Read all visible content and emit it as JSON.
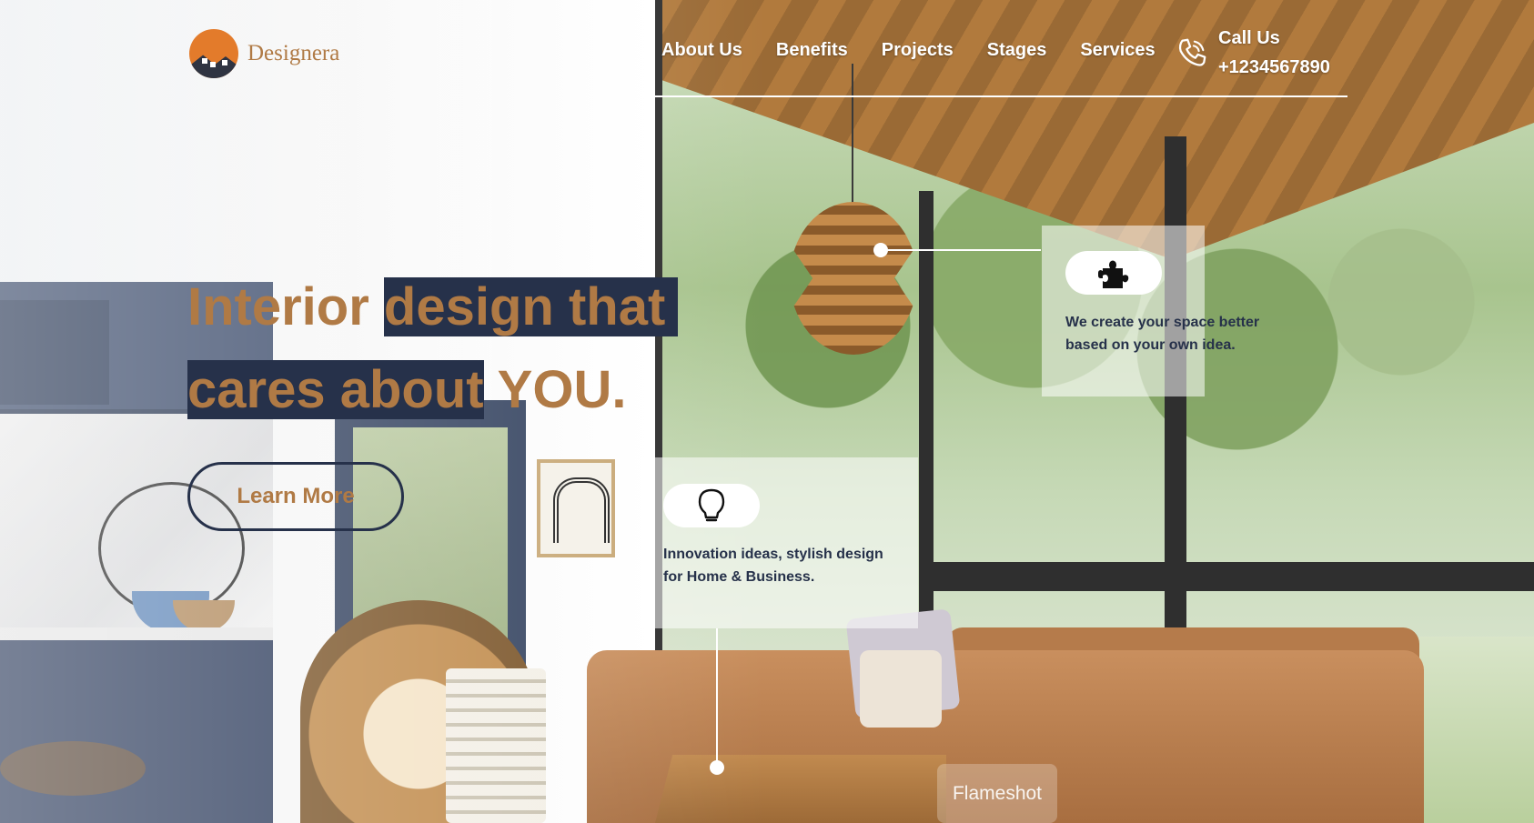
{
  "logo": {
    "name": "Designera",
    "color": "#b07a45",
    "mark_color": "#e37b2b"
  },
  "nav": {
    "items": [
      {
        "label": "About Us"
      },
      {
        "label": "Benefits"
      },
      {
        "label": "Projects"
      },
      {
        "label": "Stages"
      },
      {
        "label": "Services"
      }
    ]
  },
  "call": {
    "label": "Call Us",
    "phone": "+1234567890",
    "icon": "phone-icon"
  },
  "hero": {
    "line1_plain": "Interior ",
    "line1_highlight": "design that",
    "line2_highlight": "cares about",
    "line2_plain": " YOU.",
    "accent_color": "#b07a45",
    "highlight_color": "#26314a",
    "cta_label": "Learn More"
  },
  "features": [
    {
      "icon": "puzzle-icon",
      "text_line1": "We create your space better",
      "text_line2": "based on your own idea."
    },
    {
      "icon": "lightbulb-icon",
      "text_line1": "Innovation ideas, stylish design",
      "text_line2": "for Home & Business."
    }
  ],
  "watermark": {
    "label": "Flameshot"
  }
}
